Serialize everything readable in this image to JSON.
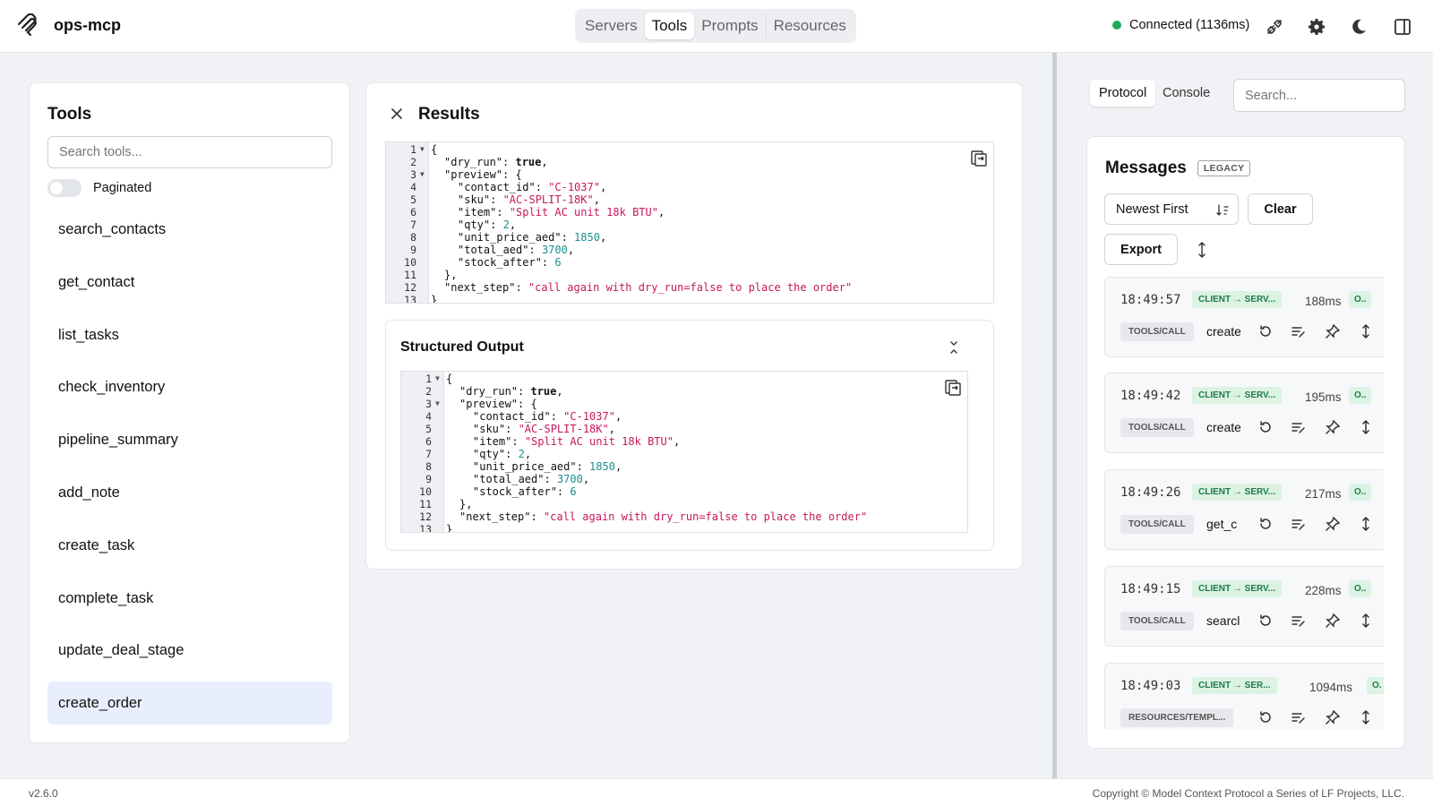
{
  "header": {
    "app_name": "ops-mcp",
    "tabs": [
      {
        "label": "Servers"
      },
      {
        "label": "Tools"
      },
      {
        "label": "Prompts"
      },
      {
        "label": "Resources"
      }
    ],
    "active_tab": "Tools",
    "connection_status": "Connected (1136ms)",
    "status_color": "#1faa58"
  },
  "tools_panel": {
    "title": "Tools",
    "search_placeholder": "Search tools...",
    "paginated_label": "Paginated",
    "tools": [
      "search_contacts",
      "get_contact",
      "list_tasks",
      "check_inventory",
      "pipeline_summary",
      "add_note",
      "create_task",
      "complete_task",
      "update_deal_stage",
      "create_order"
    ],
    "selected_tool": "create_order"
  },
  "results_panel": {
    "title": "Results",
    "line_numbers": [
      "1",
      "2",
      "3",
      "4",
      "5",
      "6",
      "7",
      "8",
      "9",
      "10",
      "11",
      "12",
      "13"
    ],
    "code": {
      "l1": "{",
      "l2_key": "\"dry_run\"",
      "l2_val": "true",
      "l3_key": "\"preview\"",
      "l3_val": "{",
      "l4_key": "\"contact_id\"",
      "l4_val": "\"C-1037\"",
      "l5_key": "\"sku\"",
      "l5_val": "\"AC-SPLIT-18K\"",
      "l6_key": "\"item\"",
      "l6_val": "\"Split AC unit 18k BTU\"",
      "l7_key": "\"qty\"",
      "l7_val": "2",
      "l8_key": "\"unit_price_aed\"",
      "l8_val": "1850",
      "l9_key": "\"total_aed\"",
      "l9_val": "3700",
      "l10_key": "\"stock_after\"",
      "l10_val": "6",
      "l11": "},",
      "l12_key": "\"next_step\"",
      "l12_val": "\"call again with dry_run=false to place the order\"",
      "l13": "}"
    },
    "structured_title": "Structured Output"
  },
  "right_panel": {
    "tabs": [
      "Protocol",
      "Console"
    ],
    "search_placeholder": "Search...",
    "messages_title": "Messages",
    "legacy_badge": "LEGACY",
    "sort_value": "Newest First",
    "clear_label": "Clear",
    "export_label": "Export",
    "messages": [
      {
        "time": "18:49:57",
        "direction": "CLIENT → SERV...",
        "duration": "188ms",
        "status": "O..",
        "method": "TOOLS/CALL",
        "name": "create"
      },
      {
        "time": "18:49:42",
        "direction": "CLIENT → SERV...",
        "duration": "195ms",
        "status": "O..",
        "method": "TOOLS/CALL",
        "name": "create"
      },
      {
        "time": "18:49:26",
        "direction": "CLIENT → SERV...",
        "duration": "217ms",
        "status": "O..",
        "method": "TOOLS/CALL",
        "name": "get_c"
      },
      {
        "time": "18:49:15",
        "direction": "CLIENT → SERV...",
        "duration": "228ms",
        "status": "O..",
        "method": "TOOLS/CALL",
        "name": "searcl"
      },
      {
        "time": "18:49:03",
        "direction": "CLIENT → SER...",
        "duration": "1094ms",
        "status": "O.",
        "method": "RESOURCES/TEMPL...",
        "name": ""
      }
    ]
  },
  "footer": {
    "version": "v2.6.0",
    "copyright": "Copyright © Model Context Protocol a Series of LF Projects, LLC."
  }
}
